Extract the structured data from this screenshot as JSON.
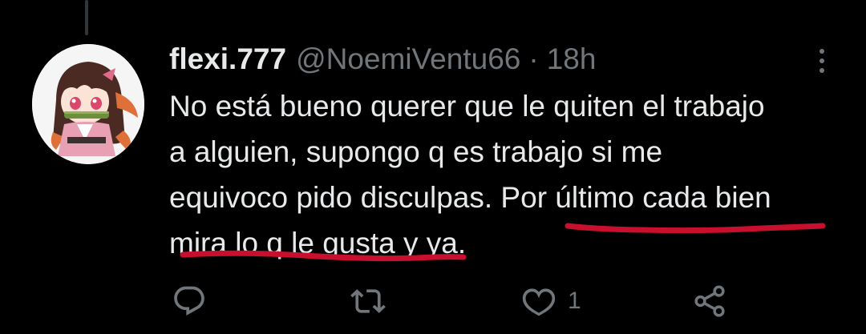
{
  "tweet": {
    "display_name": "flexi.777",
    "handle": "@NoemiVentu66",
    "separator": "·",
    "time": "18h",
    "text_lines": [
      "No está bueno querer que le quiten el trabajo",
      "a alguien, supongo q es trabajo si me",
      "equivoco pido disculpas. Por último cada bien",
      "mira lo q le gusta y ya."
    ]
  },
  "actions": {
    "reply_icon": "reply-icon",
    "retweet_icon": "retweet-icon",
    "like_icon": "like-icon",
    "like_count": "1",
    "share_icon": "share-icon"
  },
  "more_icon": "more-vertical-icon",
  "annotation_color": "#c8102e",
  "colors": {
    "background": "#000000",
    "text": "#e7e9ea",
    "secondary": "#71767b"
  }
}
